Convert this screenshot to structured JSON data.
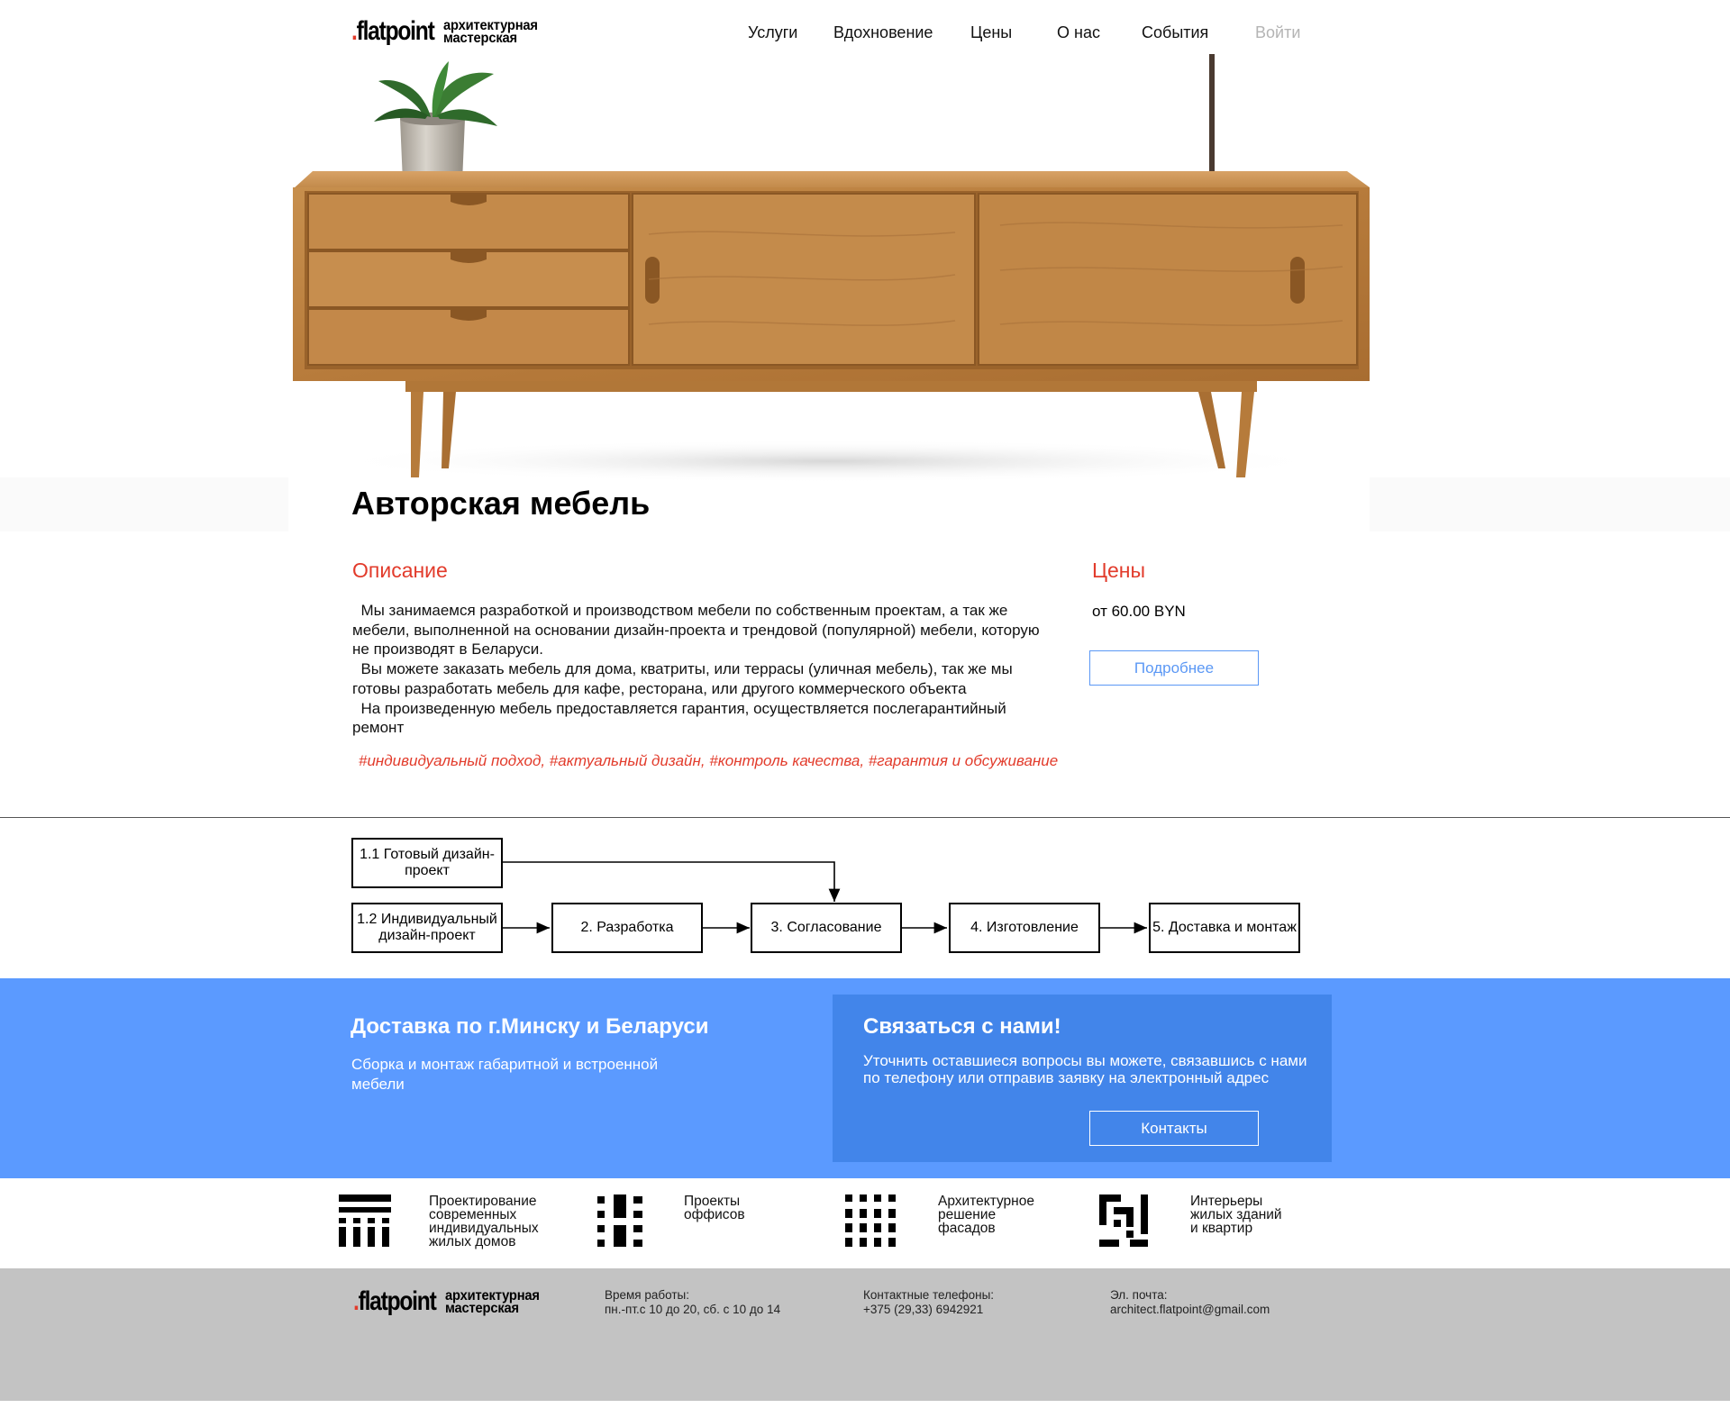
{
  "header": {
    "logo_brand_dot": ".",
    "logo_brand": "flatpoint",
    "logo_sub_line1": "архитектурная",
    "logo_sub_line2": "мастерская",
    "nav": [
      "Услуги",
      "Вдохновение",
      "Цены",
      "О нас",
      "События"
    ],
    "login": "Войти"
  },
  "page": {
    "title": "Авторская мебель"
  },
  "description": {
    "heading": "Описание",
    "paragraphs": [
      "Мы занимаемся разработкой и производством мебели по собственным проектам, а так же мебели, выполненной на основании дизайн-проекта и трендовой (популярной) мебели, которую не производят в Беларуси.",
      "Вы можете заказать мебель для дома, кватриты, или террасы (уличная мебель), так же мы готовы разработать мебель для кафе, ресторана, или другого коммерческого объекта",
      "На произведенную мебель предоставляется гарантия, осуществляется послегарантийный ремонт"
    ],
    "tags": "#индивидуальный подход, #актуальный дизайн, #контроль качества, #гарантия и обсуживание"
  },
  "prices": {
    "heading": "Цены",
    "value": "от 60.00 BYN",
    "more_button": "Подробнее"
  },
  "process": {
    "steps": [
      "1.1 Готовый дизайн-проект",
      "1.2 Индивидуальный дизайн-проект",
      "2. Разработка",
      "3. Согласование",
      "4. Изготовление",
      "5. Доставка и монтаж"
    ]
  },
  "delivery": {
    "title": "Доставка по г.Минску и Беларуси",
    "text": "Сборка и монтаж габаритной и встроенной мебели"
  },
  "contact": {
    "title": "Связаться с нами!",
    "text": "Уточнить оставшиеся вопросы вы можете, связавшись с нами по телефону или отправив заявку на электронный адрес",
    "button": "Контакты"
  },
  "services": [
    {
      "icon": "residential-houses-icon",
      "label_lines": [
        "Проектирование",
        "современных",
        "индивидуальных",
        "жилых домов"
      ]
    },
    {
      "icon": "office-projects-icon",
      "label_lines": [
        "Проекты",
        "оффисов"
      ]
    },
    {
      "icon": "facades-icon",
      "label_lines": [
        "Архитектурное",
        "решение",
        "фасадов"
      ]
    },
    {
      "icon": "interiors-icon",
      "label_lines": [
        "Интерьеры",
        "жилых зданий",
        "и квартир"
      ]
    }
  ],
  "footer": {
    "hours_label": "Время работы:",
    "hours_value": "пн.-пт.с 10 до 20, сб. с 10 до 14",
    "phones_label": "Контактные телефоны:",
    "phones_value": "+375 (29,33) 6942921",
    "email_label": "Эл. почта:",
    "email_value": "architect.flatpoint@gmail.com"
  },
  "colors": {
    "accent_red": "#e23b2b",
    "accent_blue": "#5b9aff",
    "contact_box_blue": "#4285ea",
    "footer_gray": "#c3c3c3"
  }
}
